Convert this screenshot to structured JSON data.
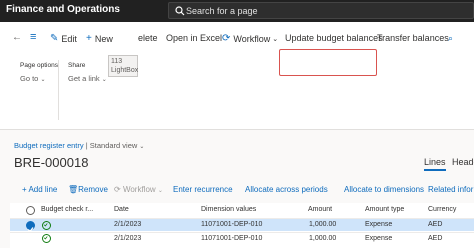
{
  "topbar": {
    "app_title": "Finance and Operations",
    "search_placeholder": "Search for a page"
  },
  "toolbar": {
    "edit": "Edit",
    "new": "New",
    "delete": "elete",
    "open_in_excel": "Open in Excel",
    "workflow": "Workflow",
    "update_budget_balances": "Update budget balances",
    "transfer_balances": "Transfer balances"
  },
  "tooltip": {
    "line1": "113",
    "line2": "LightBox"
  },
  "options": {
    "page_options_label": "Page options",
    "go_to": "Go to",
    "share_label": "Share",
    "get_a_link": "Get a link"
  },
  "breadcrumb": {
    "entity": "Budget register entry",
    "separator": "|",
    "view": "Standard view"
  },
  "record": {
    "title": "BRE-000018"
  },
  "tabs": {
    "lines": "Lines",
    "header": "Heade"
  },
  "grid_toolbar": {
    "add_line": "Add line",
    "remove": "Remove",
    "workflow": "Workflow",
    "enter_recurrence": "Enter recurrence",
    "allocate_periods": "Allocate across periods",
    "allocate_dimensions": "Allocate to dimensions",
    "related_info": "Related infor"
  },
  "grid": {
    "columns": [
      "Budget check r...",
      "Date",
      "Dimension values",
      "Amount",
      "Amount type",
      "Currency"
    ],
    "rows": [
      {
        "date": "2/1/2023",
        "dimension": "11071001-DEP-010",
        "amount": "1,000.00",
        "amount_type": "Expense",
        "currency": "AED"
      },
      {
        "date": "2/1/2023",
        "dimension": "11071001-DEP-010",
        "amount": "1,000.00",
        "amount_type": "Expense",
        "currency": "AED"
      }
    ]
  },
  "colors": {
    "accent": "#0f6cbd",
    "topbar": "#212121",
    "highlight": "#d9534f",
    "selected_row": "#cfe4fa",
    "check_green": "#107c10"
  }
}
